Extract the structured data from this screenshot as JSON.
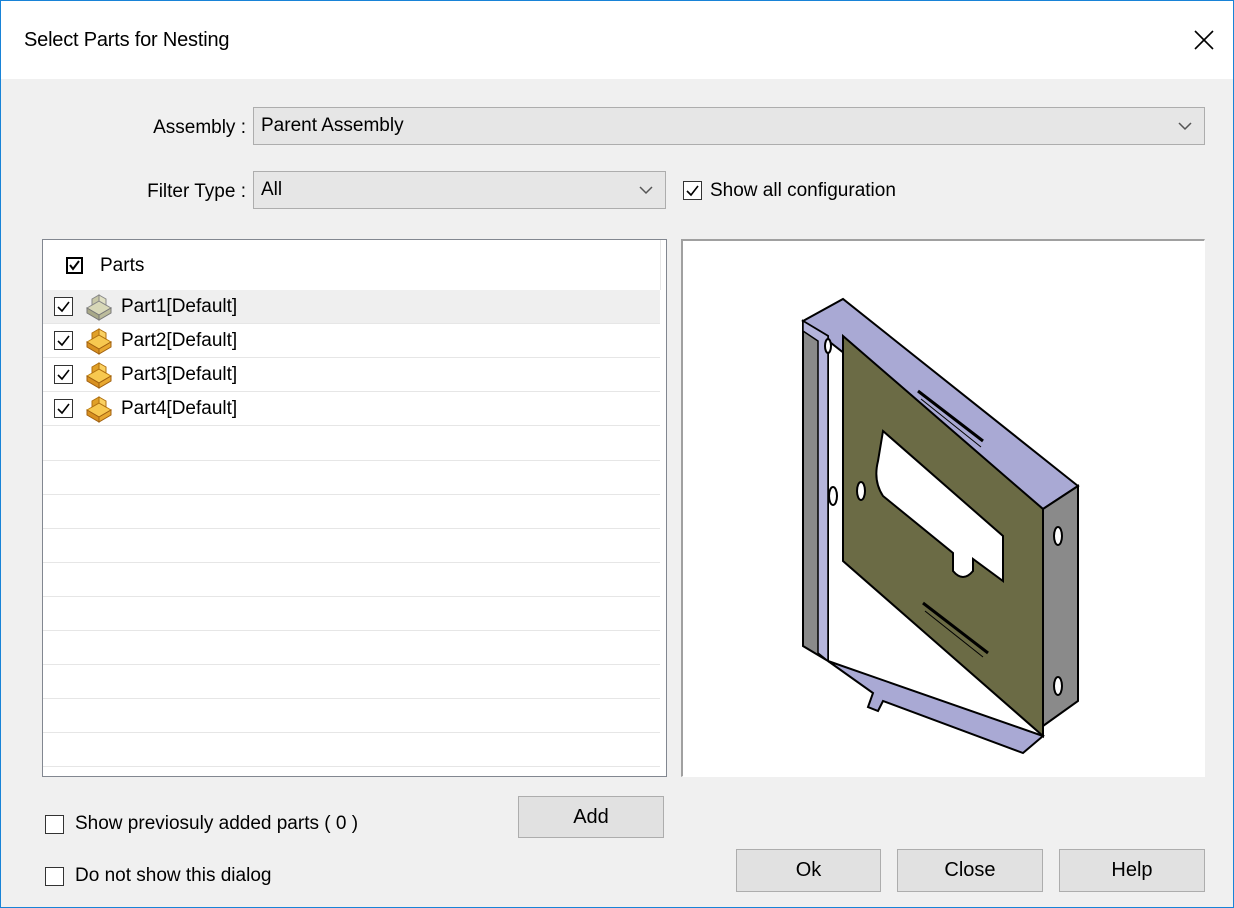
{
  "window": {
    "title": "Select Parts for Nesting"
  },
  "assembly": {
    "label": "Assembly :",
    "value": "Parent Assembly"
  },
  "filter": {
    "label": "Filter Type :",
    "value": "All"
  },
  "show_all_config": {
    "label": "Show all configuration",
    "checked": true
  },
  "parts_list": {
    "header_label": "Parts",
    "header_checked": true,
    "items": [
      {
        "name": "Part1[Default]",
        "checked": true,
        "icon": "part-icon",
        "icon_color": "#c7c7a0"
      },
      {
        "name": "Part2[Default]",
        "checked": true,
        "icon": "part-icon",
        "icon_color": "#f0b030"
      },
      {
        "name": "Part3[Default]",
        "checked": true,
        "icon": "part-icon",
        "icon_color": "#f0b030"
      },
      {
        "name": "Part4[Default]",
        "checked": true,
        "icon": "part-icon",
        "icon_color": "#f0b030"
      }
    ]
  },
  "preview": {
    "icon": "bracket-part-preview",
    "colors": {
      "face": "#a9a9d4",
      "inner": "#6b6b45",
      "edge": "#000000"
    }
  },
  "footer": {
    "show_previous_label": "Show previosuly added parts  ( 0 )",
    "show_previous_checked": false,
    "dont_show_label": "Do not show this dialog",
    "dont_show_checked": false,
    "add_label": "Add",
    "ok_label": "Ok",
    "close_label": "Close",
    "help_label": "Help"
  },
  "colors": {
    "accent_border": "#1883d7",
    "dialog_bg": "#f0f0f0"
  }
}
